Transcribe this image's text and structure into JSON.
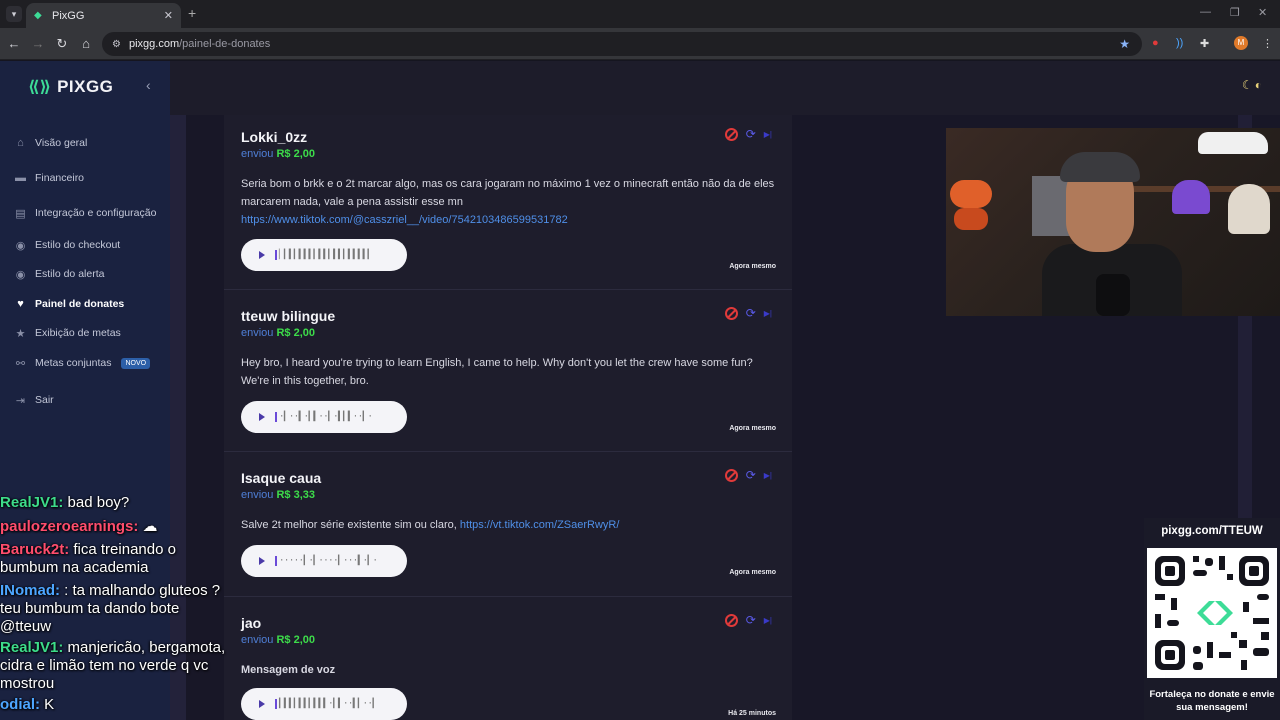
{
  "browser": {
    "tab_title": "PixGG",
    "url_host": "pixgg.com",
    "url_path": "/painel-de-donates",
    "profile_initial": "M"
  },
  "sidebar": {
    "logo_text": "PIXGG",
    "items": [
      {
        "label": "Visão geral",
        "icon": "home-icon"
      },
      {
        "label": "Financeiro",
        "icon": "wallet-icon"
      },
      {
        "label": "Integração e configuração",
        "icon": "settings-icon"
      },
      {
        "label": "Estilo do checkout",
        "icon": "palette-icon"
      },
      {
        "label": "Estilo do alerta",
        "icon": "palette-icon"
      },
      {
        "label": "Painel de donates",
        "icon": "donate-icon",
        "active": true
      },
      {
        "label": "Exibição de metas",
        "icon": "star-icon"
      },
      {
        "label": "Metas conjuntas",
        "icon": "link-icon",
        "badge": "NOVO"
      },
      {
        "label": "Sair",
        "icon": "logout-icon"
      }
    ]
  },
  "donations": [
    {
      "name": "Lokki_0zz",
      "sent_label": "enviou",
      "amount": "R$ 2,00",
      "message": "Seria bom o brkk e o 2t marcar algo, mas os cara jogaram no máximo 1 vez o minecraft então não da de eles marcarem nada, vale a pena assistir esse mn",
      "link": "https://www.tiktok.com/@casszriel__/video/7542103486599531782",
      "waveform": "▏▎▍▎▍▍▍▎▍▍▎▍▍▎▍▍▍▍▎",
      "time": "Agora mesmo"
    },
    {
      "name": "tteuw bilingue",
      "sent_label": "enviou",
      "amount": "R$ 2,00",
      "message": "Hey bro, I heard you're trying to learn English, I came to help. Why don't you let the crew have some fun? We're in this together, bro.",
      "link": "",
      "waveform": "·▎··▍·▎▍··▎·▍▎▍··▎·",
      "time": "Agora mesmo"
    },
    {
      "name": "Isaque caua",
      "sent_label": "enviou",
      "amount": "R$ 3,33",
      "message": "Salve 2t melhor série existente sim ou claro,",
      "link": "https://vt.tiktok.com/ZSaerRwyR/",
      "waveform": "·····▎·▎····▎···▍·▎·",
      "time": "Agora mesmo"
    },
    {
      "name": "jao",
      "sent_label": "enviou",
      "amount": "R$ 2,00",
      "message": "Mensagem de voz",
      "link": "",
      "waveform": "▎▍▍▎▍▍▎▍▍▍·▎▍··▍▎··▎",
      "time": "Há 25 minutos"
    }
  ],
  "chat": [
    {
      "user": "RealJV1:",
      "color": "#3ddc8a",
      "text": "bad boy?"
    },
    {
      "user": "paulozeroearnings:",
      "color": "#ff4d6d",
      "text": ""
    },
    {
      "user": "Baruck2t:",
      "color": "#ff4d6d",
      "text": "fica treinando o bumbum na academia"
    },
    {
      "user": "INomad:",
      "color": "#4da6ff",
      "text": ": ta malhando gluteos ? teu bumbum ta dando bote @tteuw"
    },
    {
      "user": "RealJV1:",
      "color": "#3ddc8a",
      "text": "manjericão, bergamota, cidra e limão tem no verde q vc mostrou"
    },
    {
      "user": "odial:",
      "color": "#4da6ff",
      "text": "K"
    }
  ],
  "qr_panel": {
    "url": "pixgg.com/TTEUW",
    "footer": "Fortaleça no donate e envie sua mensagem!"
  },
  "colors": {
    "accent_green": "#3ddc97",
    "amount_green": "#3ddc4a",
    "link_blue": "#4f8fe8",
    "ban_red": "#e03a3a"
  }
}
